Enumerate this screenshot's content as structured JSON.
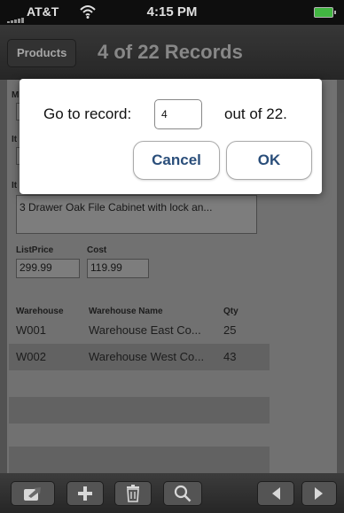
{
  "status_bar": {
    "carrier": "AT&T",
    "time": "4:15 PM"
  },
  "nav": {
    "back_label": "Products",
    "title": "4 of 22 Records"
  },
  "form": {
    "label_m": "M",
    "label_it1": "It",
    "label_it2": "It",
    "item_description": "3 Drawer Oak File Cabinet with lock an...",
    "list_price_label": "ListPrice",
    "list_price": "299.99",
    "cost_label": "Cost",
    "cost": "119.99"
  },
  "warehouse_table": {
    "headers": [
      "Warehouse",
      "Warehouse Name",
      "Qty"
    ],
    "rows": [
      {
        "warehouse": "W001",
        "name": "Warehouse East Co...",
        "qty": "25"
      },
      {
        "warehouse": "W002",
        "name": "Warehouse West Co...",
        "qty": "43"
      }
    ]
  },
  "dialog": {
    "prompt": "Go to record:",
    "input_value": "4",
    "suffix": "out of 22.",
    "cancel_label": "Cancel",
    "ok_label": "OK"
  },
  "toolbar": {
    "icons": [
      "export-icon",
      "add-icon",
      "trash-icon",
      "search-icon",
      "previous-icon",
      "next-icon"
    ]
  },
  "colors": {
    "dialog_button_text": "#2a4e7a",
    "battery": "#4cd04c"
  }
}
